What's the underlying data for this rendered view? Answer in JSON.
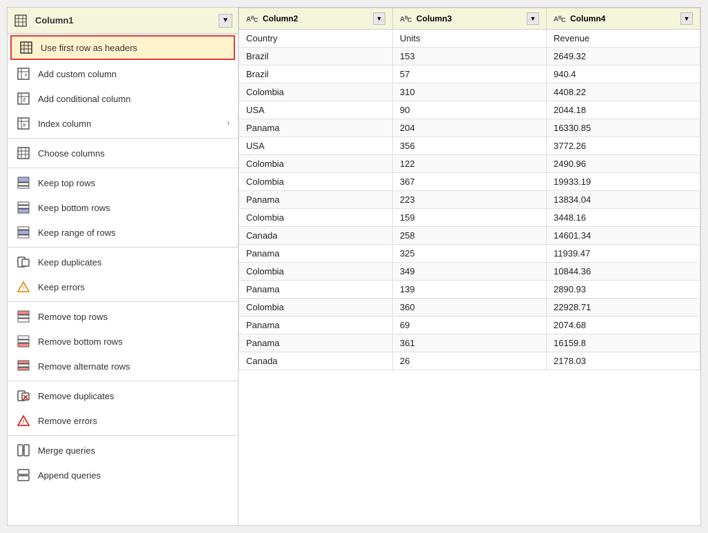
{
  "menu": {
    "column_header": {
      "label": "Column1",
      "dropdown_symbol": "▼"
    },
    "items": [
      {
        "id": "use-first-row",
        "label": "Use first row as headers",
        "icon": "table-icon",
        "highlighted": true,
        "has_arrow": false
      },
      {
        "id": "add-custom-col",
        "label": "Add custom column",
        "icon": "custom-col-icon",
        "highlighted": false,
        "has_arrow": false
      },
      {
        "id": "add-conditional-col",
        "label": "Add conditional column",
        "icon": "conditional-col-icon",
        "highlighted": false,
        "has_arrow": false
      },
      {
        "id": "index-column",
        "label": "Index column",
        "icon": "index-col-icon",
        "highlighted": false,
        "has_arrow": true
      },
      {
        "id": "sep1",
        "type": "separator"
      },
      {
        "id": "choose-columns",
        "label": "Choose columns",
        "icon": "choose-col-icon",
        "highlighted": false,
        "has_arrow": false
      },
      {
        "id": "sep2",
        "type": "separator"
      },
      {
        "id": "keep-top-rows",
        "label": "Keep top rows",
        "icon": "keep-top-icon",
        "highlighted": false,
        "has_arrow": false
      },
      {
        "id": "keep-bottom-rows",
        "label": "Keep bottom rows",
        "icon": "keep-bottom-icon",
        "highlighted": false,
        "has_arrow": false
      },
      {
        "id": "keep-range-rows",
        "label": "Keep range of rows",
        "icon": "keep-range-icon",
        "highlighted": false,
        "has_arrow": false
      },
      {
        "id": "sep3",
        "type": "separator"
      },
      {
        "id": "keep-duplicates",
        "label": "Keep duplicates",
        "icon": "keep-dupes-icon",
        "highlighted": false,
        "has_arrow": false
      },
      {
        "id": "keep-errors",
        "label": "Keep errors",
        "icon": "keep-errors-icon",
        "highlighted": false,
        "has_arrow": false
      },
      {
        "id": "sep4",
        "type": "separator"
      },
      {
        "id": "remove-top-rows",
        "label": "Remove top rows",
        "icon": "remove-top-icon",
        "highlighted": false,
        "has_arrow": false
      },
      {
        "id": "remove-bottom-rows",
        "label": "Remove bottom rows",
        "icon": "remove-bottom-icon",
        "highlighted": false,
        "has_arrow": false
      },
      {
        "id": "remove-alternate-rows",
        "label": "Remove alternate rows",
        "icon": "remove-alt-icon",
        "highlighted": false,
        "has_arrow": false
      },
      {
        "id": "sep5",
        "type": "separator"
      },
      {
        "id": "remove-duplicates",
        "label": "Remove duplicates",
        "icon": "remove-dupes-icon",
        "highlighted": false,
        "has_arrow": false
      },
      {
        "id": "remove-errors",
        "label": "Remove errors",
        "icon": "remove-errors-icon",
        "highlighted": false,
        "has_arrow": false
      },
      {
        "id": "sep6",
        "type": "separator"
      },
      {
        "id": "merge-queries",
        "label": "Merge queries",
        "icon": "merge-icon",
        "highlighted": false,
        "has_arrow": false
      },
      {
        "id": "append-queries",
        "label": "Append queries",
        "icon": "append-icon",
        "highlighted": false,
        "has_arrow": false
      }
    ]
  },
  "table": {
    "columns": [
      {
        "id": "col1",
        "label": "Column2",
        "type": "ABC"
      },
      {
        "id": "col2",
        "label": "Column3",
        "type": "ABC"
      },
      {
        "id": "col3",
        "label": "Column4",
        "type": "ABC"
      }
    ],
    "rows": [
      [
        "Country",
        "Units",
        "Revenue"
      ],
      [
        "Brazil",
        "153",
        "2649.32"
      ],
      [
        "Brazil",
        "57",
        "940.4"
      ],
      [
        "Colombia",
        "310",
        "4408.22"
      ],
      [
        "USA",
        "90",
        "2044.18"
      ],
      [
        "Panama",
        "204",
        "16330.85"
      ],
      [
        "USA",
        "356",
        "3772.26"
      ],
      [
        "Colombia",
        "122",
        "2490.96"
      ],
      [
        "Colombia",
        "367",
        "19933.19"
      ],
      [
        "Panama",
        "223",
        "13834.04"
      ],
      [
        "Colombia",
        "159",
        "3448.16"
      ],
      [
        "Canada",
        "258",
        "14601.34"
      ],
      [
        "Panama",
        "325",
        "11939.47"
      ],
      [
        "Colombia",
        "349",
        "10844.36"
      ],
      [
        "Panama",
        "139",
        "2890.93"
      ],
      [
        "Colombia",
        "360",
        "22928.71"
      ],
      [
        "Panama",
        "69",
        "2074.68"
      ],
      [
        "Panama",
        "361",
        "16159.8"
      ],
      [
        "Canada",
        "26",
        "2178.03"
      ]
    ]
  }
}
